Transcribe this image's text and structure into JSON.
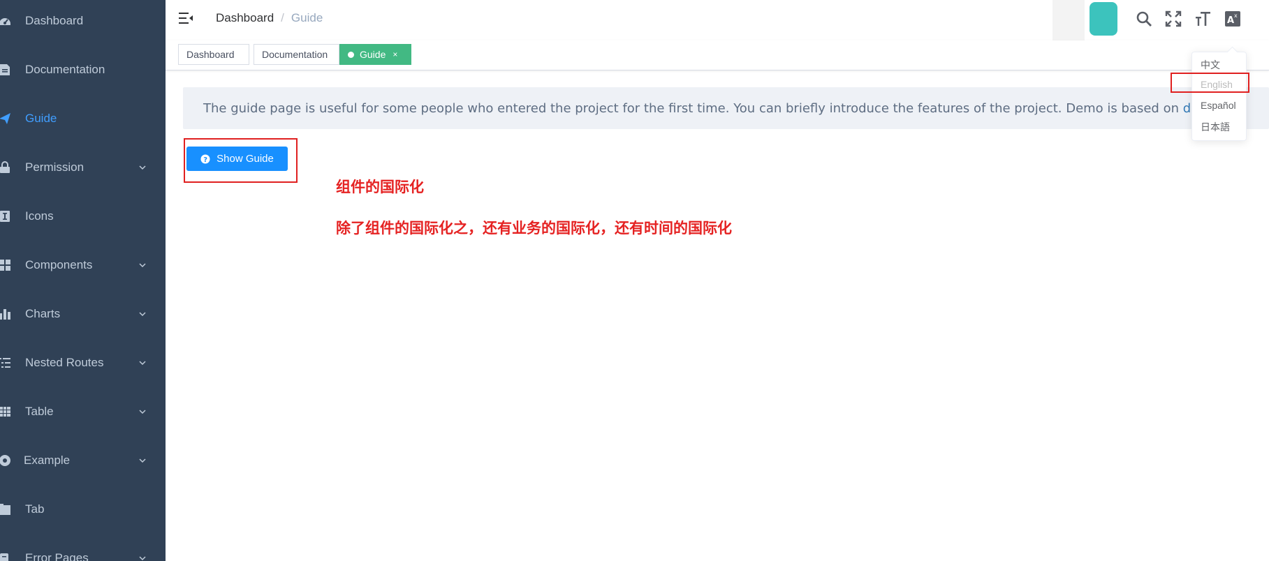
{
  "sidebar": {
    "items": [
      {
        "label": "Dashboard",
        "icon": "dashboard-icon",
        "submenu": false
      },
      {
        "label": "Documentation",
        "icon": "documentation-icon",
        "submenu": false
      },
      {
        "label": "Guide",
        "icon": "guide-icon",
        "submenu": false,
        "active": true
      },
      {
        "label": "Permission",
        "icon": "lock-icon",
        "submenu": true
      },
      {
        "label": "Icons",
        "icon": "icon-icon",
        "submenu": false
      },
      {
        "label": "Components",
        "icon": "component-icon",
        "submenu": true
      },
      {
        "label": "Charts",
        "icon": "chart-icon",
        "submenu": true
      },
      {
        "label": "Nested Routes",
        "icon": "nested-icon",
        "submenu": true
      },
      {
        "label": "Table",
        "icon": "table-icon",
        "submenu": true
      },
      {
        "label": "Example",
        "icon": "example-icon",
        "submenu": true
      },
      {
        "label": "Tab",
        "icon": "tab-icon",
        "submenu": false
      },
      {
        "label": "Error Pages",
        "icon": "bug-icon",
        "submenu": true
      }
    ],
    "background": "#304156",
    "text_color": "#bfcbd9",
    "active_color": "#409eff"
  },
  "navbar": {
    "breadcrumb": {
      "home": "Dashboard",
      "separator": "/",
      "current": "Guide"
    },
    "icons": [
      "search-icon",
      "fullscreen-icon",
      "size-icon",
      "language-icon"
    ]
  },
  "tags": [
    {
      "label": "Dashboard",
      "active": false
    },
    {
      "label": "Documentation",
      "active": false
    },
    {
      "label": "Guide",
      "active": true,
      "close": "×"
    }
  ],
  "main": {
    "info_text": "The guide page is useful for some people who entered the project for the first time. You can briefly introduce the features of the project. Demo is based on ",
    "info_link": "drive",
    "show_guide_label": "Show Guide"
  },
  "annotations": {
    "line1": "组件的国际化",
    "line2": "除了组件的国际化之，还有业务的国际化，还有时间的国际化"
  },
  "language_menu": {
    "options": [
      {
        "label": "中文",
        "disabled": false
      },
      {
        "label": "English",
        "disabled": true
      },
      {
        "label": "Español",
        "disabled": false
      },
      {
        "label": "日本語",
        "disabled": false
      }
    ]
  },
  "colors": {
    "tag_active": "#42b983",
    "button_primary": "#1890ff",
    "annotation": "#e52222"
  }
}
